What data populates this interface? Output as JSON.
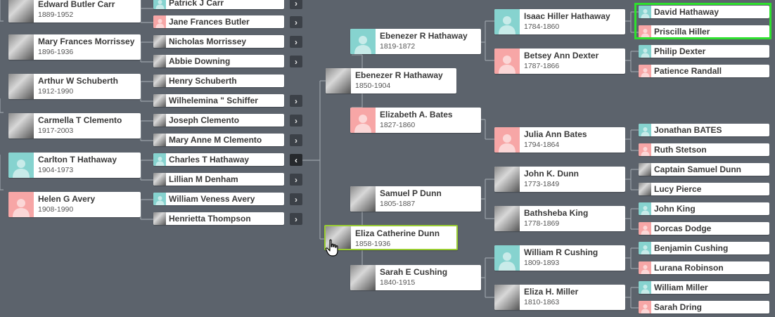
{
  "colors": {
    "background": "#5c636c",
    "male": "#86d3cf",
    "female": "#f7a6a6",
    "selected_border": "#9acd32",
    "highlight": "#2ee02e"
  },
  "icons": {
    "expand": "chevron-right-icon",
    "collapse": "chevron-left-icon"
  },
  "people": [
    {
      "id": "edward_carr",
      "name": "Edward Butler Carr",
      "dates": "1889-1952",
      "gender": "male",
      "photo": true,
      "size": "big"
    },
    {
      "id": "mary_morrissey",
      "name": "Mary Frances Morrissey",
      "dates": "1896-1936",
      "gender": "female",
      "photo": true,
      "size": "big"
    },
    {
      "id": "arthur_schuberth",
      "name": "Arthur W Schuberth",
      "dates": "1912-1990",
      "gender": "male",
      "photo": true,
      "size": "big"
    },
    {
      "id": "carmella_clemento",
      "name": "Carmella T Clemento",
      "dates": "1917-2003",
      "gender": "female",
      "photo": true,
      "size": "big"
    },
    {
      "id": "carlton_hathaway",
      "name": "Carlton T Hathaway",
      "dates": "1904-1973",
      "gender": "male",
      "photo": false,
      "size": "big"
    },
    {
      "id": "helen_avery",
      "name": "Helen G Avery",
      "dates": "1908-1990",
      "gender": "female",
      "photo": false,
      "size": "big"
    },
    {
      "id": "patrick_carr",
      "name": "Patrick J Carr",
      "gender": "male",
      "photo": false,
      "size": "small",
      "chevron": "right"
    },
    {
      "id": "jane_butler",
      "name": "Jane Frances Butler",
      "gender": "female",
      "photo": false,
      "size": "small",
      "chevron": "right"
    },
    {
      "id": "nicholas_morrissey",
      "name": "Nicholas Morrissey",
      "gender": "male",
      "photo": true,
      "size": "small",
      "chevron": "right"
    },
    {
      "id": "abbie_downing",
      "name": "Abbie Downing",
      "gender": "female",
      "photo": true,
      "size": "small",
      "chevron": "right"
    },
    {
      "id": "henry_schuberth",
      "name": "Henry Schuberth",
      "gender": "male",
      "photo": true,
      "size": "small",
      "chevron": null
    },
    {
      "id": "wilhelemina_schiffer",
      "name": "Wilhelemina \" Schiffer",
      "gender": "female",
      "photo": true,
      "size": "small",
      "chevron": "right"
    },
    {
      "id": "joseph_clemento",
      "name": "Joseph Clemento",
      "gender": "male",
      "photo": true,
      "size": "small",
      "chevron": "right"
    },
    {
      "id": "mary_anne_clemento",
      "name": "Mary Anne M Clemento",
      "gender": "female",
      "photo": true,
      "size": "small",
      "chevron": "right"
    },
    {
      "id": "charles_hathaway",
      "name": "Charles T Hathaway",
      "gender": "male",
      "photo": false,
      "size": "small",
      "chevron": "left"
    },
    {
      "id": "lillian_denham",
      "name": "Lillian M Denham",
      "gender": "female",
      "photo": true,
      "size": "small",
      "chevron": "right"
    },
    {
      "id": "william_avery",
      "name": "William Veness Avery",
      "gender": "male",
      "photo": false,
      "size": "small",
      "chevron": "right"
    },
    {
      "id": "henrietta_thompson",
      "name": "Henrietta Thompson",
      "gender": "female",
      "photo": true,
      "size": "small",
      "chevron": "right"
    },
    {
      "id": "ebenezer_1850",
      "name": "Ebenezer R Hathaway",
      "dates": "1850-1904",
      "gender": "male",
      "photo": true,
      "size": "big"
    },
    {
      "id": "eliza_dunn",
      "name": "Eliza Catherine Dunn",
      "dates": "1858-1936",
      "gender": "female",
      "photo": true,
      "size": "big",
      "selected": true
    },
    {
      "id": "ebenezer_1819",
      "name": "Ebenezer R Hathaway",
      "dates": "1819-1872",
      "gender": "male",
      "photo": false,
      "size": "big"
    },
    {
      "id": "elizabeth_bates",
      "name": "Elizabeth A. Bates",
      "dates": "1827-1860",
      "gender": "female",
      "photo": false,
      "size": "big"
    },
    {
      "id": "samuel_dunn",
      "name": "Samuel P Dunn",
      "dates": "1805-1887",
      "gender": "male",
      "photo": true,
      "size": "big"
    },
    {
      "id": "sarah_cushing",
      "name": "Sarah E Cushing",
      "dates": "1840-1915",
      "gender": "female",
      "photo": true,
      "size": "big"
    },
    {
      "id": "isaac_hathaway",
      "name": "Isaac Hiller Hathaway",
      "dates": "1784-1860",
      "gender": "male",
      "photo": false,
      "size": "big"
    },
    {
      "id": "betsey_dexter",
      "name": "Betsey Ann Dexter",
      "dates": "1787-1866",
      "gender": "female",
      "photo": false,
      "size": "big"
    },
    {
      "id": "julia_bates",
      "name": "Julia Ann Bates",
      "dates": "1794-1864",
      "gender": "female",
      "photo": false,
      "size": "big"
    },
    {
      "id": "john_dunn",
      "name": "John K. Dunn",
      "dates": "1773-1849",
      "gender": "male",
      "photo": true,
      "size": "big"
    },
    {
      "id": "bathsheba_king",
      "name": "Bathsheba King",
      "dates": "1778-1869",
      "gender": "female",
      "photo": true,
      "size": "big"
    },
    {
      "id": "william_cushing",
      "name": "William R Cushing",
      "dates": "1809-1893",
      "gender": "male",
      "photo": false,
      "size": "big"
    },
    {
      "id": "eliza_miller",
      "name": "Eliza H. Miller",
      "dates": "1810-1863",
      "gender": "female",
      "photo": true,
      "size": "big"
    },
    {
      "id": "david_hathaway",
      "name": "David Hathaway",
      "gender": "male",
      "photo": false,
      "size": "small"
    },
    {
      "id": "priscilla_hiller",
      "name": "Priscilla Hiller",
      "gender": "female",
      "photo": false,
      "size": "small"
    },
    {
      "id": "philip_dexter",
      "name": "Philip Dexter",
      "gender": "male",
      "photo": false,
      "size": "small"
    },
    {
      "id": "patience_randall",
      "name": "Patience Randall",
      "gender": "female",
      "photo": false,
      "size": "small"
    },
    {
      "id": "jonathan_bates",
      "name": "Jonathan BATES",
      "gender": "male",
      "photo": false,
      "size": "small"
    },
    {
      "id": "ruth_stetson",
      "name": "Ruth Stetson",
      "gender": "female",
      "photo": false,
      "size": "small"
    },
    {
      "id": "captain_samuel_dunn",
      "name": "Captain Samuel Dunn",
      "gender": "male",
      "photo": true,
      "size": "small"
    },
    {
      "id": "lucy_pierce",
      "name": "Lucy Pierce",
      "gender": "female",
      "photo": true,
      "size": "small"
    },
    {
      "id": "john_king",
      "name": "John King",
      "gender": "male",
      "photo": false,
      "size": "small"
    },
    {
      "id": "dorcas_dodge",
      "name": "Dorcas Dodge",
      "gender": "female",
      "photo": false,
      "size": "small"
    },
    {
      "id": "benjamin_cushing",
      "name": "Benjamin Cushing",
      "gender": "male",
      "photo": false,
      "size": "small"
    },
    {
      "id": "lurana_robinson",
      "name": "Lurana Robinson",
      "gender": "female",
      "photo": false,
      "size": "small"
    },
    {
      "id": "william_miller",
      "name": "William Miller",
      "gender": "male",
      "photo": false,
      "size": "small"
    },
    {
      "id": "sarah_dring",
      "name": "Sarah Dring",
      "gender": "female",
      "photo": false,
      "size": "small"
    }
  ]
}
